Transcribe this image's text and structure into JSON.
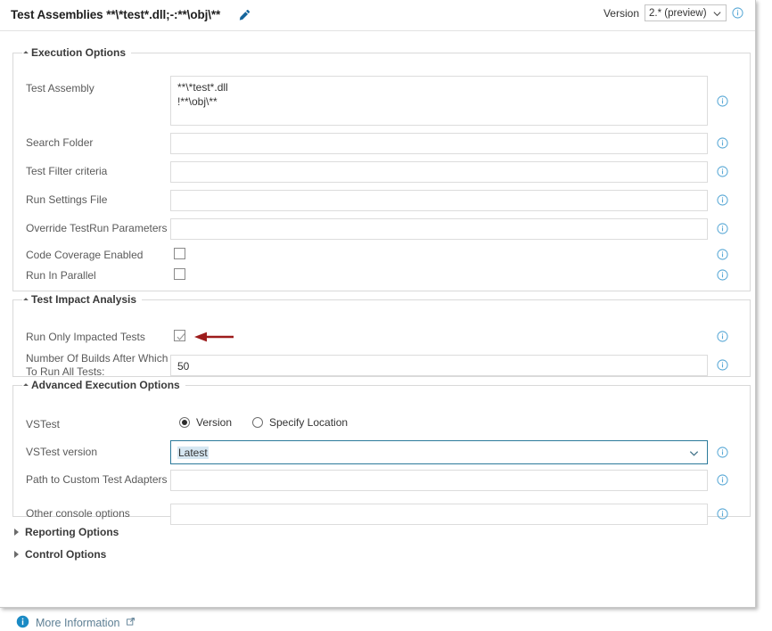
{
  "titlebar": {
    "task_title": "Test Assemblies **\\*test*.dll;-:**\\obj\\**",
    "edit_icon": "pencil-icon",
    "version_label": "Version",
    "version_value": "2.* (preview)",
    "version_info_icon": "info-icon"
  },
  "sections": {
    "execution_options": {
      "title": "Execution Options",
      "expanded": true,
      "fields": [
        {
          "label": "Test Assembly",
          "value": "**\\*test*.dll\n!**\\obj\\**",
          "type": "textarea",
          "info": "info-icon"
        },
        {
          "label": "Search Folder",
          "value": "",
          "type": "text",
          "info": "info-icon"
        },
        {
          "label": "Test Filter criteria",
          "value": "",
          "type": "text",
          "info": "info-icon"
        },
        {
          "label": "Run Settings File",
          "value": "",
          "type": "text",
          "info": "info-icon"
        },
        {
          "label": "Override TestRun Parameters",
          "value": "",
          "type": "text",
          "info": "info-icon"
        },
        {
          "label": "Code Coverage Enabled",
          "value": "",
          "type": "checkbox",
          "checked": false,
          "info": "info-icon"
        },
        {
          "label": "Run In Parallel",
          "value": "",
          "type": "checkbox",
          "checked": false,
          "info": "info-icon"
        }
      ]
    },
    "test_impact_analysis": {
      "title": "Test Impact Analysis",
      "expanded": true,
      "fields": [
        {
          "label": "Run Only Impacted Tests",
          "value": "",
          "type": "checkbox",
          "checked": true,
          "info": "info-icon"
        },
        {
          "label": "Number Of Builds After Which\nTo Run All Tests:",
          "value": "50",
          "type": "text",
          "info": "info-icon"
        }
      ]
    },
    "advanced_execution_options": {
      "title": "Advanced Execution Options",
      "expanded": true,
      "vstest": {
        "label": "VSTest",
        "options": [
          {
            "label": "Version",
            "selected": true
          },
          {
            "label": "Specify Location",
            "selected": false
          }
        ]
      },
      "fields": [
        {
          "label": "VSTest version",
          "value": "Latest",
          "type": "select",
          "info": "info-icon"
        },
        {
          "label": "Path to Custom Test Adapters",
          "value": "",
          "type": "text",
          "info": "info-icon"
        },
        {
          "label": "Other console options",
          "value": "",
          "type": "text",
          "info": "info-icon"
        }
      ]
    },
    "reporting_options": {
      "title": "Reporting Options",
      "expanded": false
    },
    "control_options": {
      "title": "Control Options",
      "expanded": false
    }
  },
  "footer": {
    "info_icon": "info-filled-icon",
    "more_information": "More Information",
    "external_link_glyph": "↗"
  },
  "colors": {
    "accent_blue": "#0078d4",
    "info_icon_blue": "#5aa9d6",
    "arrow_red": "#a01818",
    "focus_border": "#2b7a9b",
    "selection_highlight": "#d6e7f2",
    "border_gray": "#d9d9d9",
    "label_gray": "#5a5a5a"
  }
}
